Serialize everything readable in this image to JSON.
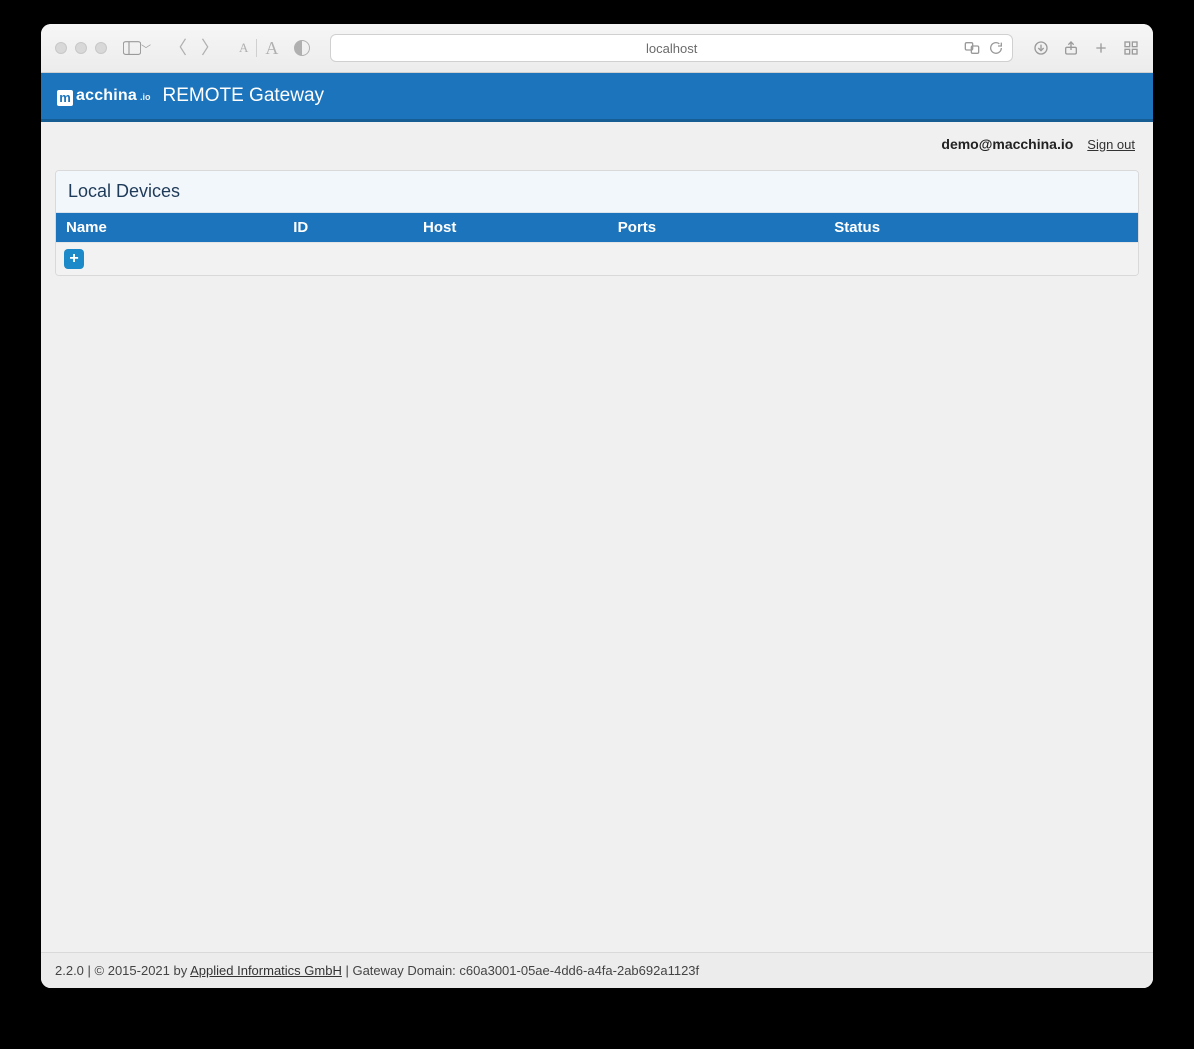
{
  "browser": {
    "address": "localhost"
  },
  "header": {
    "brand_main": "acchina",
    "brand_io": ".io",
    "app_title": "REMOTE Gateway"
  },
  "user": {
    "email": "demo@macchina.io",
    "signout_label": "Sign out"
  },
  "panel": {
    "title": "Local Devices",
    "columns": {
      "name": "Name",
      "id": "ID",
      "host": "Host",
      "ports": "Ports",
      "status": "Status"
    },
    "add_label": "+"
  },
  "footer": {
    "version": "2.2.0",
    "copyright_prefix": " | © 2015-2021 by ",
    "company": "Applied Informatics GmbH",
    "domain_prefix": " | Gateway Domain: ",
    "domain": "c60a3001-05ae-4dd6-a4fa-2ab692a1123f"
  }
}
